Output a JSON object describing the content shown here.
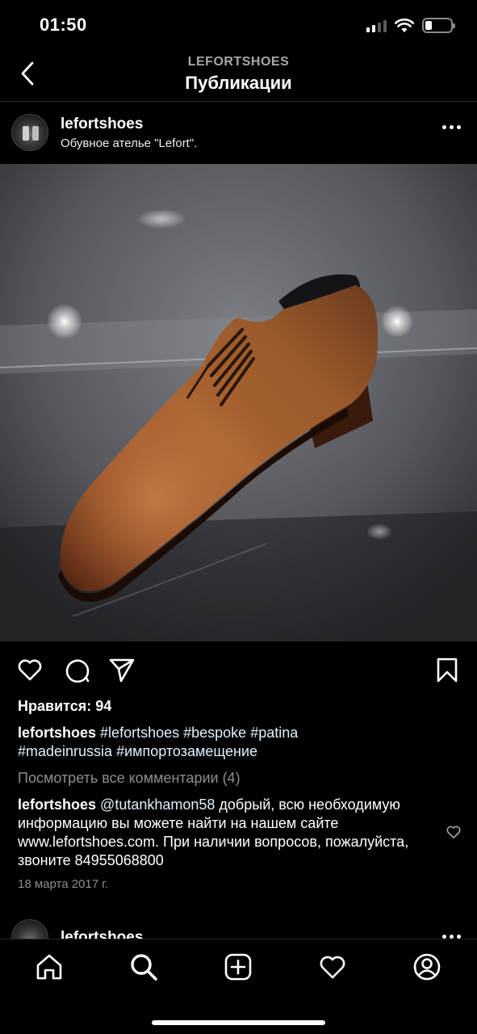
{
  "status_bar": {
    "time": "01:50",
    "battery_level": 0.25
  },
  "nav": {
    "subtitle": "LEFORTSHOES",
    "title": "Публикации",
    "back_icon": "chevron-left-icon"
  },
  "post": {
    "username": "lefortshoes",
    "location": "Обувное ателье \"Lefort\".",
    "likes": "Нравится: 94",
    "caption": {
      "username": "lefortshoes",
      "tags": [
        "#lefortshoes",
        "#bespoke",
        "#patina",
        "#madeinrussia",
        "#импортозамещение"
      ]
    },
    "view_comments": "Посмотреть все комментарии (4)",
    "comment": {
      "username": "lefortshoes",
      "mention": "@tutankhamon58",
      "text": " добрый, всю необходимую информацию вы можете найти на нашем сайте www.lefortshoes.com. При наличии вопросов, пожалуйста, звоните 84955068800"
    },
    "date": "18 марта 2017 г."
  },
  "next_post": {
    "username": "lefortshoes"
  },
  "tabbar": {
    "items": [
      "home-icon",
      "search-icon",
      "create-post-icon",
      "activity-heart-icon",
      "profile-icon"
    ]
  },
  "colors": {
    "background": "#000000",
    "secondary_text": "#8e8e8e",
    "hashtag": "#e0f1ff",
    "divider": "#262626"
  }
}
